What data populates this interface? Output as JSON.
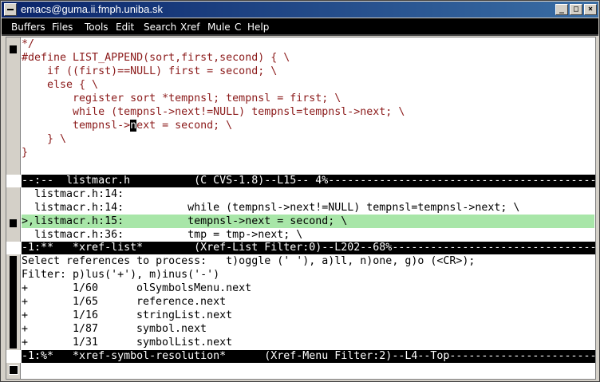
{
  "window": {
    "title": "emacs@guma.ii.fmph.uniba.sk",
    "minimize": "_",
    "maximize": "□",
    "close": "×"
  },
  "menubar": [
    "Buffers",
    "Files",
    "Tools",
    "Edit",
    "Search",
    "Xref",
    "Mule",
    "C",
    "Help"
  ],
  "editor": {
    "lines": [
      "*/",
      "#define LIST_APPEND(sort,first,second) { \\",
      "    if ((first)==NULL) first = second; \\",
      "    else { \\",
      "        register sort *tempnsl; tempnsl = first; \\",
      "        while (tempnsl->next!=NULL) tempnsl=tempnsl->next; \\",
      "        tempnsl->",
      "    } \\",
      "}"
    ],
    "cursor_char": "n",
    "cursor_rest": "ext = second; \\",
    "modeline": "--:--  listmacr.h          (C CVS-1.8)--L15-- 4%---------------------------------------------------------"
  },
  "xref_list": {
    "rows": [
      "  listmacr.h:14:",
      "  listmacr.h:14:          while (tempnsl->next!=NULL) tempnsl=tempnsl->next; \\",
      ">,listmacr.h:15:          tempnsl->next = second; \\",
      "  listmacr.h:36:          tmp = tmp->next; \\"
    ],
    "modeline": "-1:**   *xref-list*        (Xref-List Filter:0)--L202--68%----------------------------------------------"
  },
  "xref_menu": {
    "header1": "Select references to process:   t)oggle (' '), a)ll, n)one, g)o (<CR>);",
    "header2": "Filter: p)lus('+'), m)inus('-')",
    "items": [
      {
        "mark": "+",
        "count": "1/60",
        "symbol": "olSymbolsMenu.next"
      },
      {
        "mark": "+",
        "count": "1/65",
        "symbol": "reference.next"
      },
      {
        "mark": "+",
        "count": "1/16",
        "symbol": "stringList.next"
      },
      {
        "mark": "+",
        "count": "1/87",
        "symbol": "symbol.next"
      },
      {
        "mark": "+",
        "count": "1/31",
        "symbol": "symbolList.next"
      }
    ],
    "modeline": "-1:%*   *xref-symbol-resolution*      (Xref-Menu Filter:2)--L4--Top----------------------------------------"
  }
}
